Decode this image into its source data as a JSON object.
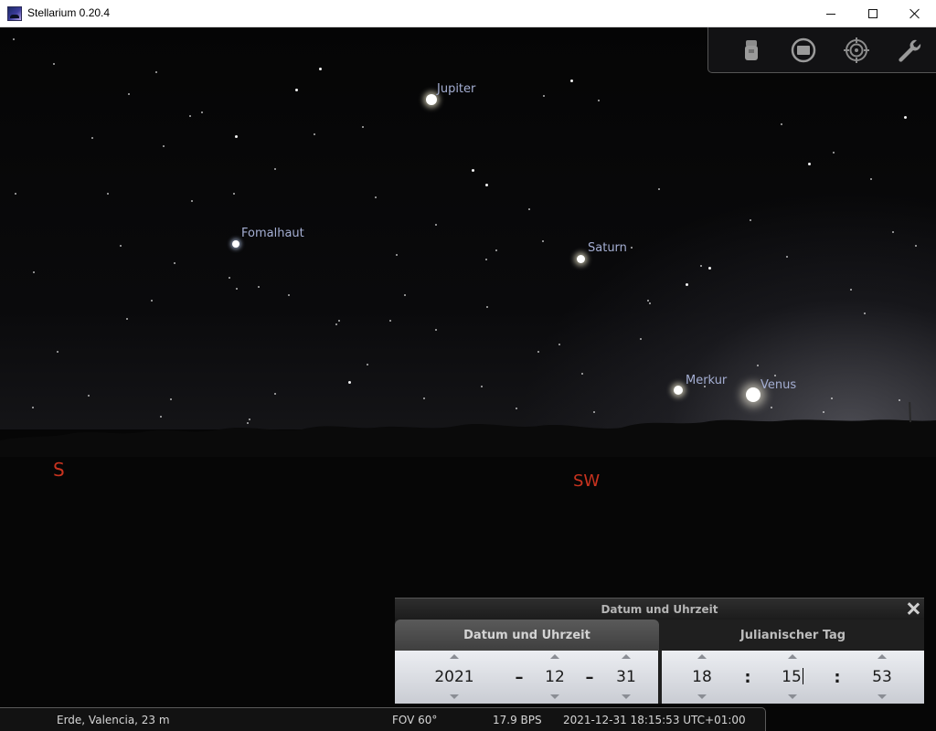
{
  "window": {
    "title": "Stellarium 0.20.4",
    "icon": "stellarium-app-icon",
    "controls": [
      "minimize-icon",
      "maximize-icon",
      "close-icon"
    ]
  },
  "sky": {
    "objects": [
      {
        "label": "Jupiter"
      },
      {
        "label": "Fomalhaut"
      },
      {
        "label": "Saturn"
      },
      {
        "label": "Merkur"
      },
      {
        "label": "Venus"
      }
    ],
    "cardinals": [
      {
        "label": "S"
      },
      {
        "label": "SW"
      }
    ],
    "colors": {
      "label": "#a4aed2",
      "cardinal": "#c8331f",
      "sky": "#050505"
    }
  },
  "toolbar": {
    "buttons": [
      {
        "icon": "telescope-icon"
      },
      {
        "icon": "window-icon"
      },
      {
        "icon": "target-icon"
      },
      {
        "icon": "wrench-icon"
      }
    ]
  },
  "datetime_dialog": {
    "title": "Datum und Uhrzeit",
    "tabs": [
      {
        "label": "Datum und Uhrzeit",
        "active": true
      },
      {
        "label": "Julianischer Tag",
        "active": false
      }
    ],
    "date": {
      "year": "2021",
      "month": "12",
      "day": "31",
      "separator": "–"
    },
    "time": {
      "hour": "18",
      "minute": "15",
      "second": "53",
      "separator": ":"
    }
  },
  "statusbar": {
    "location": "Erde, Valencia, 23 m",
    "fov": "FOV 60°",
    "fps": "17.9 BPS",
    "datetime": "2021-12-31 18:15:53 UTC+01:00"
  }
}
